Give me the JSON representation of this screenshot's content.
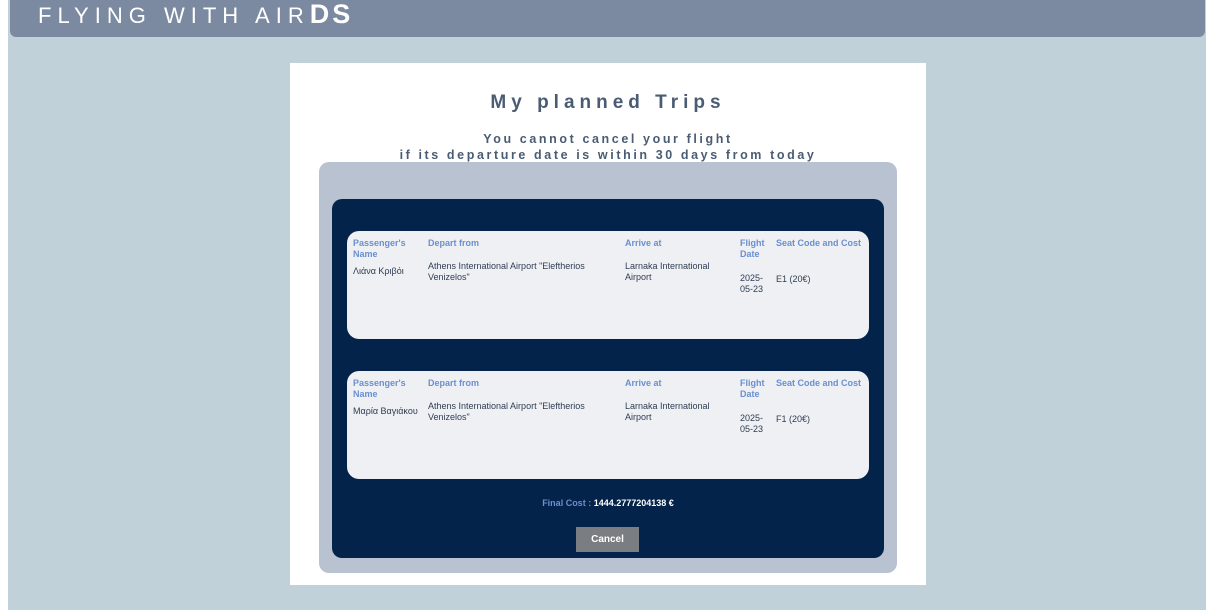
{
  "brand": {
    "text_regular": "FLYING WITH AIR",
    "text_bold": "DS"
  },
  "page": {
    "title": "My planned Trips",
    "notice_line1": "You cannot cancel your flight",
    "notice_line2": "if its departure date is within 30 days from today"
  },
  "table_headers": {
    "passenger": "Passenger's Name",
    "depart": "Depart from",
    "arrive": "Arrive at",
    "date": "Flight Date",
    "seat": "Seat Code and Cost"
  },
  "trips": [
    {
      "passenger": "Λιάνα Κριβόι",
      "depart": "Athens International Airport \"Eleftherios Venizelos\"",
      "arrive": "Larnaka International Airport",
      "date": "2025-05-23",
      "seat": "E1 (20€)"
    },
    {
      "passenger": "Μαρία Βαγιάκου",
      "depart": "Athens International Airport \"Eleftherios Venizelos\"",
      "arrive": "Larnaka International Airport",
      "date": "2025-05-23",
      "seat": "F1 (20€)"
    }
  ],
  "summary": {
    "final_cost_label": "Final Cost :",
    "final_cost_value": "1444.2777204138 €",
    "cancel_label": "Cancel"
  },
  "colors": {
    "background": "#c0d1da",
    "topbar": "#7b8aa0",
    "card_outer": "#b9c2d0",
    "card_inner": "#03234a",
    "header_text": "#6b8fcf",
    "button": "#7a7d82"
  }
}
